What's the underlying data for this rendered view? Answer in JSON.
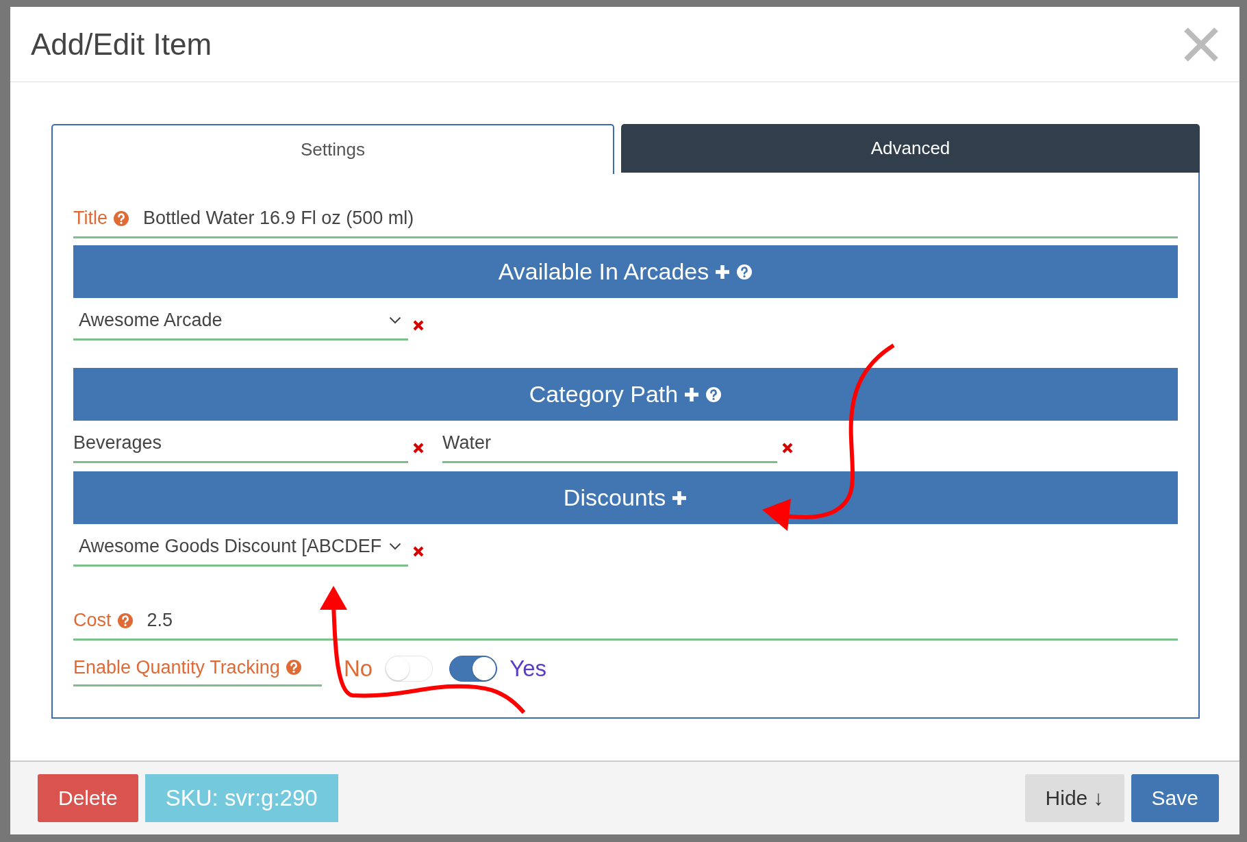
{
  "window": {
    "title": "Add/Edit Item"
  },
  "tabs": [
    {
      "label": "Settings",
      "selected": true
    },
    {
      "label": "Advanced",
      "selected": false
    }
  ],
  "title_field": {
    "label": "Title",
    "value": "Bottled Water 16.9 Fl oz (500 ml)"
  },
  "sections": [
    {
      "heading": "Available In Arcades",
      "add": true,
      "help": true,
      "fields": [
        {
          "kind": "select",
          "value": "Awesome Arcade"
        }
      ]
    },
    {
      "heading": "Category Path",
      "add": true,
      "help": true,
      "fields": [
        {
          "kind": "text",
          "value": "Beverages"
        },
        {
          "kind": "text",
          "value": "Water"
        }
      ]
    },
    {
      "heading": "Discounts",
      "add": true,
      "help": false,
      "fields": [
        {
          "kind": "select",
          "value": "Awesome Goods Discount [ABCDEF"
        }
      ]
    }
  ],
  "cost_field": {
    "label": "Cost",
    "value": "2.5"
  },
  "quantity_tracking": {
    "label": "Enable Quantity Tracking",
    "options": [
      {
        "label": "No",
        "selected": false
      },
      {
        "label": "Yes",
        "selected": true
      }
    ]
  },
  "footer": {
    "delete": "Delete",
    "sku": "SKU: svr:g:290",
    "hide": "Hide ↓",
    "save": "Save"
  }
}
